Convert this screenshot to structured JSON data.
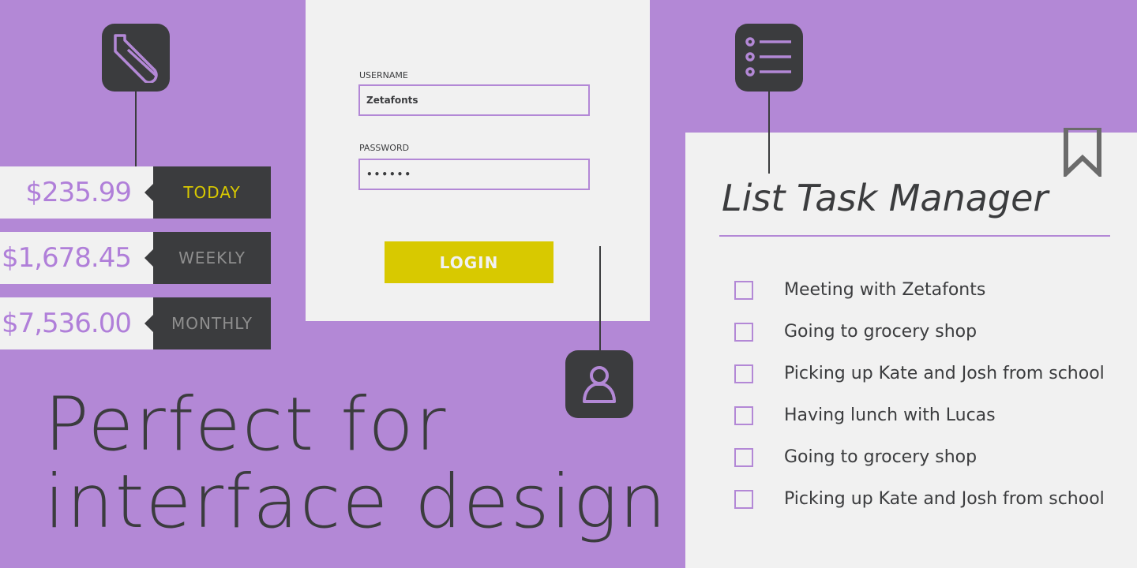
{
  "colors": {
    "background": "#b388d6",
    "dark": "#3b3c3e",
    "panel": "#f1f1f1",
    "accent_yellow": "#d8c900",
    "accent_purple": "#b07fd9"
  },
  "icons": [
    "paperclip-icon",
    "user-icon",
    "list-icon",
    "bookmark-icon"
  ],
  "login": {
    "username_label": "USERNAME",
    "username_value": "Zetafonts",
    "password_label": "PASSWORD",
    "password_value": "••••••",
    "button": "LOGIN"
  },
  "prices": [
    {
      "amount": "$235.99",
      "period": "TODAY"
    },
    {
      "amount": "$1,678.45",
      "period": "WEEKLY"
    },
    {
      "amount": "$7,536.00",
      "period": "MONTHLY"
    }
  ],
  "headline": {
    "line1": "Perfect for",
    "line2": "interface design"
  },
  "tasks": {
    "title": "List Task Manager",
    "items": [
      "Meeting with Zetafonts",
      "Going to grocery shop",
      "Picking up Kate and Josh from school",
      "Having lunch with Lucas",
      "Going to grocery shop",
      "Picking up Kate and Josh from school"
    ]
  }
}
